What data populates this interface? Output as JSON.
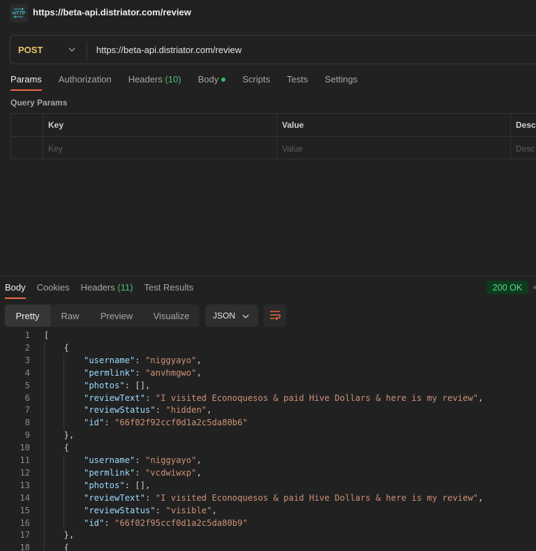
{
  "header": {
    "icon": "http-icon",
    "title": "https://beta-api.distriator.com/review"
  },
  "request": {
    "method": "POST",
    "url": "https://beta-api.distriator.com/review",
    "tabs": [
      {
        "label": "Params",
        "active": true
      },
      {
        "label": "Authorization"
      },
      {
        "label": "Headers",
        "count": "(10)"
      },
      {
        "label": "Body",
        "indicator": "green-dot"
      },
      {
        "label": "Scripts"
      },
      {
        "label": "Tests"
      },
      {
        "label": "Settings"
      }
    ],
    "query_params": {
      "label": "Query Params",
      "columns": [
        "Key",
        "Value",
        "Desc"
      ],
      "placeholder_row": [
        "Key",
        "Value",
        "Desc"
      ]
    }
  },
  "response": {
    "tabs": [
      {
        "label": "Body",
        "active": true
      },
      {
        "label": "Cookies"
      },
      {
        "label": "Headers",
        "count": "(11)"
      },
      {
        "label": "Test Results"
      }
    ],
    "status": "200 OK",
    "status_color": "#5fd38a",
    "view_modes": [
      "Pretty",
      "Raw",
      "Preview",
      "Visualize"
    ],
    "active_view": "Pretty",
    "format": "JSON",
    "wrap_icon": "wrap-lines-icon",
    "code_lines": [
      {
        "n": "1",
        "indent": 0,
        "parts": [
          [
            "p",
            "["
          ]
        ]
      },
      {
        "n": "2",
        "indent": 1,
        "parts": [
          [
            "p",
            "{"
          ]
        ]
      },
      {
        "n": "3",
        "indent": 2,
        "parts": [
          [
            "k",
            "\"username\""
          ],
          [
            "p",
            ": "
          ],
          [
            "s",
            "\"niggyayo\""
          ],
          [
            "p",
            ","
          ]
        ]
      },
      {
        "n": "4",
        "indent": 2,
        "parts": [
          [
            "k",
            "\"permlink\""
          ],
          [
            "p",
            ": "
          ],
          [
            "s",
            "\"anvhmgwo\""
          ],
          [
            "p",
            ","
          ]
        ]
      },
      {
        "n": "5",
        "indent": 2,
        "parts": [
          [
            "k",
            "\"photos\""
          ],
          [
            "p",
            ": [],"
          ]
        ]
      },
      {
        "n": "6",
        "indent": 2,
        "parts": [
          [
            "k",
            "\"reviewText\""
          ],
          [
            "p",
            ": "
          ],
          [
            "s",
            "\"I visited Econoquesos & paid Hive Dollars & here is my review\""
          ],
          [
            "p",
            ","
          ]
        ]
      },
      {
        "n": "7",
        "indent": 2,
        "parts": [
          [
            "k",
            "\"reviewStatus\""
          ],
          [
            "p",
            ": "
          ],
          [
            "s",
            "\"hidden\""
          ],
          [
            "p",
            ","
          ]
        ]
      },
      {
        "n": "8",
        "indent": 2,
        "parts": [
          [
            "k",
            "\"id\""
          ],
          [
            "p",
            ": "
          ],
          [
            "s",
            "\"66f02f92ccf0d1a2c5da80b6\""
          ]
        ]
      },
      {
        "n": "9",
        "indent": 1,
        "parts": [
          [
            "p",
            "},"
          ]
        ]
      },
      {
        "n": "10",
        "indent": 1,
        "parts": [
          [
            "p",
            "{"
          ]
        ]
      },
      {
        "n": "11",
        "indent": 2,
        "parts": [
          [
            "k",
            "\"username\""
          ],
          [
            "p",
            ": "
          ],
          [
            "s",
            "\"niggyayo\""
          ],
          [
            "p",
            ","
          ]
        ]
      },
      {
        "n": "12",
        "indent": 2,
        "parts": [
          [
            "k",
            "\"permlink\""
          ],
          [
            "p",
            ": "
          ],
          [
            "s",
            "\"vcdwiwxp\""
          ],
          [
            "p",
            ","
          ]
        ]
      },
      {
        "n": "13",
        "indent": 2,
        "parts": [
          [
            "k",
            "\"photos\""
          ],
          [
            "p",
            ": [],"
          ]
        ]
      },
      {
        "n": "14",
        "indent": 2,
        "parts": [
          [
            "k",
            "\"reviewText\""
          ],
          [
            "p",
            ": "
          ],
          [
            "s",
            "\"I visited Econoquesos & paid Hive Dollars & here is my review\""
          ],
          [
            "p",
            ","
          ]
        ]
      },
      {
        "n": "15",
        "indent": 2,
        "parts": [
          [
            "k",
            "\"reviewStatus\""
          ],
          [
            "p",
            ": "
          ],
          [
            "s",
            "\"visible\""
          ],
          [
            "p",
            ","
          ]
        ]
      },
      {
        "n": "16",
        "indent": 2,
        "parts": [
          [
            "k",
            "\"id\""
          ],
          [
            "p",
            ": "
          ],
          [
            "s",
            "\"66f02f95ccf0d1a2c5da80b9\""
          ]
        ]
      },
      {
        "n": "17",
        "indent": 1,
        "parts": [
          [
            "p",
            "},"
          ]
        ]
      },
      {
        "n": "18",
        "indent": 1,
        "parts": [
          [
            "p",
            "{"
          ]
        ]
      }
    ]
  }
}
